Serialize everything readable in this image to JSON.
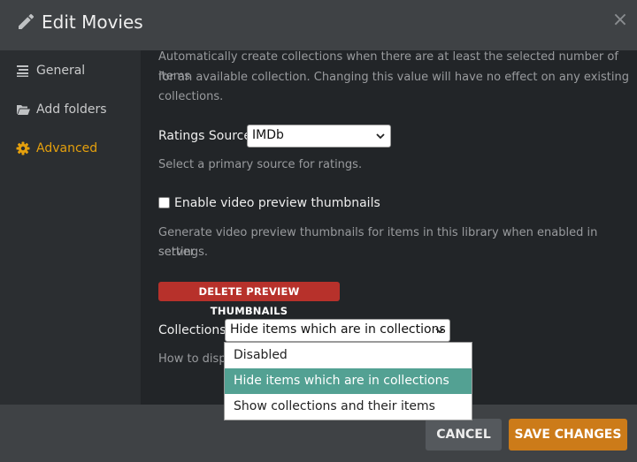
{
  "dialog": {
    "title": "Edit Movies",
    "close_glyph": "×",
    "accent_color": "#e5a00d"
  },
  "sidebar": {
    "items": [
      {
        "label": "General",
        "icon": "list-icon"
      },
      {
        "label": "Add folders",
        "icon": "folder-open-icon"
      },
      {
        "label": "Advanced",
        "icon": "gear-icon",
        "active": true
      }
    ]
  },
  "content": {
    "collections_min_help_line1": "Automatically create collections when there are at least the selected number of items",
    "collections_min_help_line2": "for an available collection. Changing this value will have no effect on any existing",
    "collections_min_help_line3": "collections.",
    "ratings": {
      "label": "Ratings Source",
      "value": "IMDb",
      "help": "Select a primary source for ratings."
    },
    "preview": {
      "checkbox_label": "Enable video preview thumbnails",
      "checked": false,
      "help_line1": "Generate video preview thumbnails for items in this library when enabled in server",
      "help_line2": "settings.",
      "delete_button": "DELETE PREVIEW THUMBNAILS"
    },
    "collections": {
      "label": "Collections",
      "value": "Hide items which are in collections",
      "help_partial": "How to displ",
      "options": [
        {
          "label": "Disabled"
        },
        {
          "label": "Hide items which are in collections",
          "selected": true
        },
        {
          "label": "Show collections and their items"
        }
      ]
    }
  },
  "footer": {
    "cancel_label": "CANCEL",
    "save_label": "SAVE CHANGES"
  }
}
